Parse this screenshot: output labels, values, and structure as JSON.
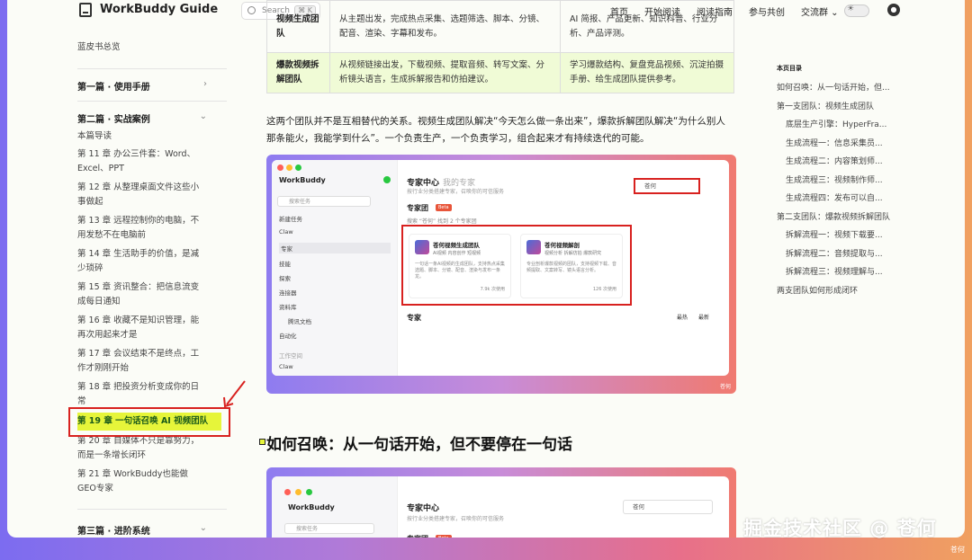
{
  "site": {
    "title": "WorkBuddy Guide",
    "search_placeholder": "Search",
    "search_kbd": "⌘ K",
    "nav": [
      "首页",
      "开始阅读",
      "阅读指南",
      "参与共创",
      "交流群 ⌄"
    ]
  },
  "sidebar": {
    "top_item": "蓝皮书总览",
    "section1": "第一篇 · 使用手册",
    "section2": "第二篇 · 实战案例",
    "section3": "第三篇 · 进阶系统",
    "items": [
      "本篇导读",
      "第 11 章 办公三件套：Word、Excel、PPT",
      "第 12 章 从整理桌面文件这些小事做起",
      "第 13 章 远程控制你的电脑，不用发愁不在电脑前",
      "第 14 章 生活助手的价值，是减少琐碎",
      "第 15 章 资讯整合：把信息流变成每日通知",
      "第 16 章 收藏不是知识管理，能再次用起来才是",
      "第 17 章 会议结束不是终点，工作才刚刚开始",
      "第 18 章 把投资分析变成你的日常",
      "第 19 章 一句话召唤 AI 视频团队",
      "第 20 章 自媒体不只是靠努力，而是一条增长闭环",
      "第 21 章 WorkBuddy也能做GEO专家"
    ]
  },
  "table": {
    "rows": [
      {
        "c1": "视频生成团队",
        "c2": "从主题出发，完成热点采集、选题筛选、脚本、分镜、配音、渲染、字幕和发布。",
        "c3": "AI 简报、产品更新、知识科普、行业分析、产品评测。"
      },
      {
        "c1": "爆款视频拆解团队",
        "c2": "从视频链接出发，下载视频、提取音频、转写文案、分析镜头语言，生成拆解报告和仿拍建议。",
        "c3": "学习爆款结构、复盘竞品视频、沉淀拍摄手册、给生成团队提供参考。"
      }
    ]
  },
  "paragraph": "这两个团队并不是互相替代的关系。视频生成团队解决“今天怎么做一条出来”，爆款拆解团队解决“为什么别人那条能火，我能学到什么”。一个负责生产，一个负责学习，组合起来才有持续迭代的可能。",
  "heading": "如何召唤：从一句话开始，但不要停在一句话",
  "screenshot": {
    "app_name": "WorkBuddy",
    "search_task": "搜索任务",
    "menu": [
      "新建任务",
      "Claw",
      "专家",
      "技能",
      "探索",
      "连接器",
      "资料库",
      "腾讯文档",
      "自动化"
    ],
    "workspace_label": "工作空间",
    "workspace_item": "Claw",
    "center_title": "专家中心",
    "center_tab2": "我的专家",
    "center_sub": "按行业分类搭建专家，召唤你的可信服务",
    "search_value": "苍何",
    "team_label": "专家团",
    "team_badge": "Beta",
    "found_text": "搜索 “苍何” 找到 2 个专家团",
    "cards": [
      {
        "name": "苍何视频生成团队",
        "tags": "AI视频  内容创作  短视频",
        "desc": "一句话一条AI视频的生成团队，支持热点采集选题、脚本、分镜、配音、渲染与发布一条龙。",
        "count": "7.9k 次使用"
      },
      {
        "name": "苍何视频解剖",
        "tags": "视频分析  拆解仿拍  爆款研究",
        "desc": "专业剖析爆款视频的团队，支持视频下载、音频提取、文案转写、镜头语言分析。",
        "count": "126 次使用"
      }
    ],
    "experts_label": "专家",
    "tab_hot": "最热",
    "tab_new": "最新",
    "caption": "苍何"
  },
  "toc": {
    "title": "本页目录",
    "items": [
      {
        "t": "如何召唤：从一句话开始，但...",
        "lvl": 0
      },
      {
        "t": "第一支团队：视频生成团队",
        "lvl": 0
      },
      {
        "t": "底层生产引擎：HyperFra...",
        "lvl": 1
      },
      {
        "t": "生成流程一：信息采集员...",
        "lvl": 1
      },
      {
        "t": "生成流程二：内容策划师...",
        "lvl": 1
      },
      {
        "t": "生成流程三：视频制作师...",
        "lvl": 1
      },
      {
        "t": "生成流程四：发布可以自...",
        "lvl": 1
      },
      {
        "t": "第二支团队：爆款视频拆解团队",
        "lvl": 0
      },
      {
        "t": "拆解流程一：视频下载要...",
        "lvl": 1
      },
      {
        "t": "拆解流程二：音频提取与...",
        "lvl": 1
      },
      {
        "t": "拆解流程三：视频理解与...",
        "lvl": 1
      },
      {
        "t": "两支团队如何形成闭环",
        "lvl": 0
      }
    ]
  },
  "watermark": "掘金技术社区 @ 苍何",
  "watermark_small": "苍何"
}
